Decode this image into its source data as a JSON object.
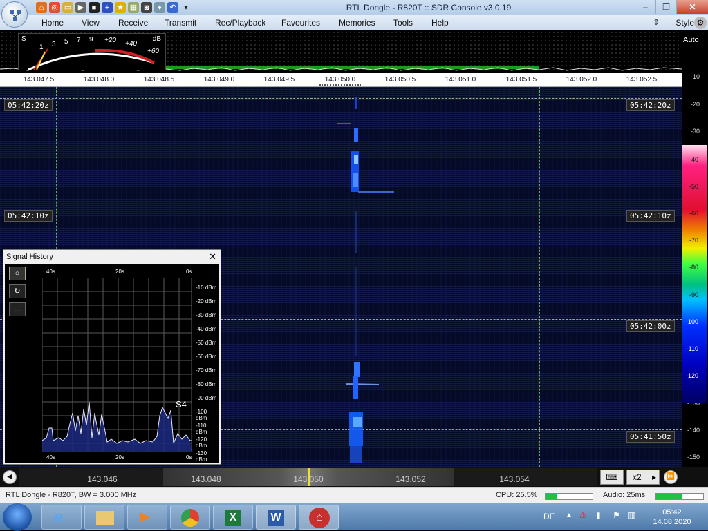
{
  "window": {
    "title": "RTL Dongle - R820T :: SDR Console v3.0.19"
  },
  "menu": {
    "items": [
      "Home",
      "View",
      "Receive",
      "Transmit",
      "Rec/Playback",
      "Favourites",
      "Memories",
      "Tools",
      "Help"
    ],
    "style_label": "Style"
  },
  "meter": {
    "s_label": "S",
    "db_label": "dB",
    "s_scale": [
      "1",
      "3",
      "5",
      "7",
      "9"
    ],
    "db_scale": [
      "+20",
      "+40",
      "+60"
    ]
  },
  "frequency_axis": [
    "143.047.5",
    "143.048.0",
    "143.048.5",
    "143.049.0",
    "143.049.5",
    "143.050.0",
    "143.050.5",
    "143.051.0",
    "143.051.5",
    "143.052.0",
    "143.052.5"
  ],
  "timestamps": [
    "05:42:20z",
    "05:42:10z",
    "05:42:00z",
    "05:41:50z"
  ],
  "right_scale": {
    "auto_label": "Auto",
    "levels": [
      "-10",
      "-20",
      "-30",
      "-40",
      "-50",
      "-60",
      "-70",
      "-80",
      "-90",
      "-100",
      "-110",
      "-120",
      "-130",
      "-140",
      "-150"
    ]
  },
  "signal_history": {
    "title": "Signal History",
    "time_labels": [
      "40s",
      "20s",
      "0s"
    ],
    "dbm_labels": [
      "-10 dBm",
      "-20 dBm",
      "-30 dBm",
      "-40 dBm",
      "-50 dBm",
      "-60 dBm",
      "-70 dBm",
      "-80 dBm",
      "-90 dBm",
      "-100 dBm",
      "-110 dBm",
      "-120 dBm",
      "-130 dBm"
    ],
    "s_reading": "S4",
    "buttons": [
      "○",
      "↻",
      "..."
    ]
  },
  "tuning_strip": {
    "freqs": [
      "143.046",
      "143.048",
      "143.050",
      "143.052",
      "143.054"
    ],
    "zoom": "x2"
  },
  "status": {
    "device": "RTL Dongle - R820T, BW = 3.000 MHz",
    "cpu": "CPU: 25.5%",
    "audio": "Audio: 25ms",
    "cpu_level": 0.25,
    "audio_level": 0.55
  },
  "taskbar": {
    "lang": "DE",
    "time": "05:42",
    "date": "14.08.2020"
  }
}
